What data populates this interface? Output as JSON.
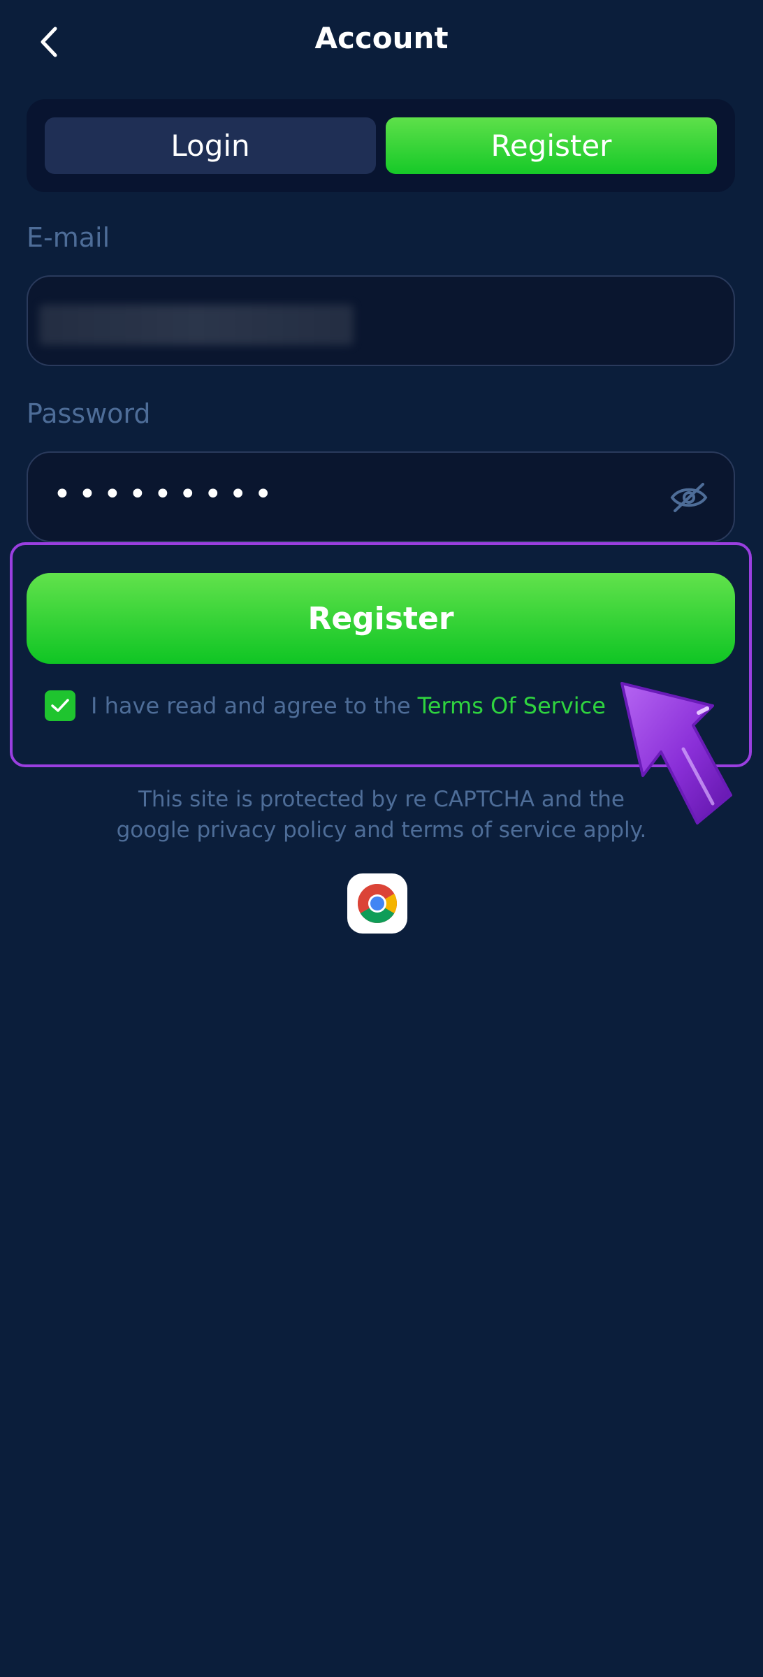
{
  "header": {
    "title": "Account",
    "back_icon": "chevron-left-icon"
  },
  "tabs": [
    {
      "label": "Login",
      "active": false
    },
    {
      "label": "Register",
      "active": true
    }
  ],
  "form": {
    "email": {
      "label": "E-mail",
      "value_obscured": true
    },
    "password": {
      "label": "Password",
      "value_masked": "•••••••••",
      "toggle_icon": "eye-off-icon"
    },
    "submit_label": "Register",
    "agreement": {
      "checked": true,
      "text": "I have read and agree to the",
      "link_text": "Terms Of Service"
    }
  },
  "captcha_notice": {
    "line1": "This site is protected by re CAPTCHA and the",
    "line2": "google privacy policy and terms of service apply."
  },
  "app_icon": "chrome-icon",
  "colors": {
    "background": "#0b1e3b",
    "accent_green": "#16c928",
    "highlight_purple": "#9a3fe0",
    "muted_text": "#4e6d98"
  }
}
